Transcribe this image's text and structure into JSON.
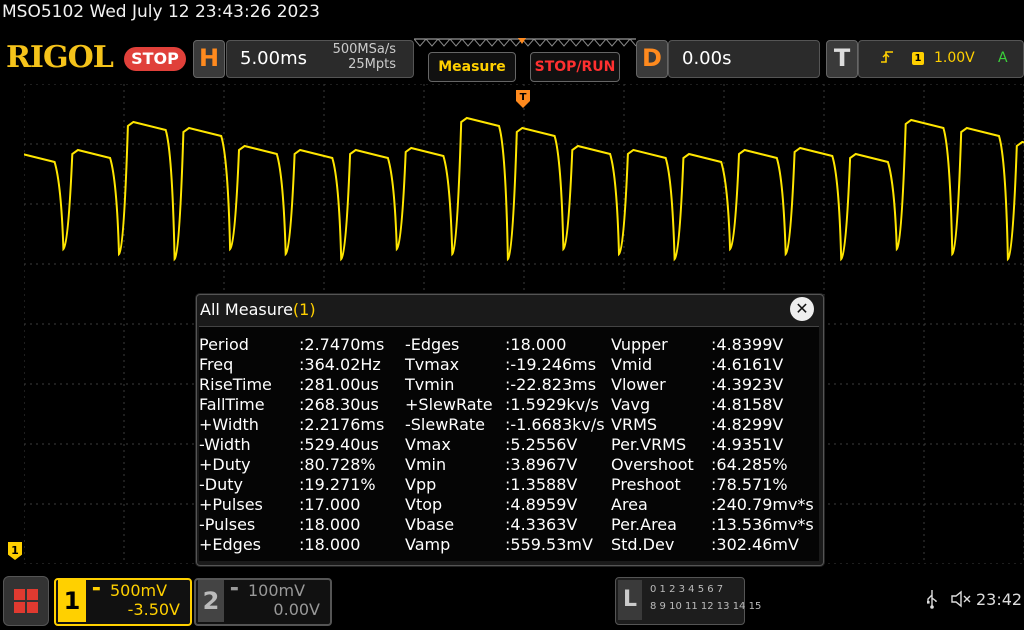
{
  "header": {
    "status_line": "MSO5102  Wed July 12 23:43:26 2023",
    "logo": "RIGOL",
    "run_state": "STOP",
    "horizontal": {
      "letter": "H",
      "timebase": "5.00ms",
      "sample_rate": "500MSa/s",
      "memory_depth": "25Mpts"
    },
    "measure_button": "Measure",
    "stoprun_button": "STOP/RUN",
    "delay": {
      "letter": "D",
      "value": "0.00s"
    },
    "trigger": {
      "letter": "T",
      "channel": "1",
      "level": "1.00V",
      "mode": "A",
      "edge_icon": "rising-edge-icon"
    }
  },
  "measure_panel": {
    "title": "All Measure",
    "count": "(1)",
    "close_icon": "close-icon",
    "columns": [
      [
        {
          "name": "Period",
          "value": ":2.7470ms"
        },
        {
          "name": "Freq",
          "value": ":364.02Hz"
        },
        {
          "name": "RiseTime",
          "value": ":281.00us"
        },
        {
          "name": "FallTime",
          "value": ":268.30us"
        },
        {
          "name": "+Width",
          "value": ":2.2176ms"
        },
        {
          "name": "-Width",
          "value": ":529.40us"
        },
        {
          "name": "+Duty",
          "value": ":80.728%"
        },
        {
          "name": "-Duty",
          "value": ":19.271%"
        },
        {
          "name": "+Pulses",
          "value": ":17.000"
        },
        {
          "name": "-Pulses",
          "value": ":18.000"
        },
        {
          "name": "+Edges",
          "value": ":18.000"
        }
      ],
      [
        {
          "name": "-Edges",
          "value": ":18.000"
        },
        {
          "name": "Tvmax",
          "value": ":-19.246ms"
        },
        {
          "name": "Tvmin",
          "value": ":-22.823ms"
        },
        {
          "name": "+SlewRate",
          "value": ":1.5929kv/s"
        },
        {
          "name": "-SlewRate",
          "value": ":-1.6683kv/s"
        },
        {
          "name": "Vmax",
          "value": ":5.2556V"
        },
        {
          "name": "Vmin",
          "value": ":3.8967V"
        },
        {
          "name": "Vpp",
          "value": ":1.3588V"
        },
        {
          "name": "Vtop",
          "value": ":4.8959V"
        },
        {
          "name": "Vbase",
          "value": ":4.3363V"
        },
        {
          "name": "Vamp",
          "value": ":559.53mV"
        }
      ],
      [
        {
          "name": "Vupper",
          "value": ":4.8399V"
        },
        {
          "name": "Vmid",
          "value": ":4.6161V"
        },
        {
          "name": "Vlower",
          "value": ":4.3923V"
        },
        {
          "name": "Vavg",
          "value": ":4.8158V"
        },
        {
          "name": "VRMS",
          "value": ":4.8299V"
        },
        {
          "name": "Per.VRMS",
          "value": ":4.9351V"
        },
        {
          "name": "Overshoot",
          "value": ":64.285%"
        },
        {
          "name": "Preshoot",
          "value": ":78.571%"
        },
        {
          "name": "Area",
          "value": ":240.79mv*s"
        },
        {
          "name": "Per.Area",
          "value": ":13.536mv*s"
        },
        {
          "name": "Std.Dev",
          "value": ":302.46mV"
        }
      ]
    ]
  },
  "channels": [
    {
      "number": "1",
      "scale": "500mV",
      "offset": "-3.50V",
      "active": true,
      "color": "#ffd000"
    },
    {
      "number": "2",
      "scale": "100mV",
      "offset": "0.00V",
      "active": false,
      "color": "#999999"
    }
  ],
  "ch1_marker": "1",
  "logic": {
    "letter": "L",
    "row1": "0 1 2 3   4 5 6 7",
    "row2": "8 9 10 11  12 13 14 15"
  },
  "status_bar": {
    "time": "23:42",
    "usb_icon": "usb-icon",
    "sound_icon": "speaker-muted-icon"
  },
  "waveform": {
    "color": "#ffe600",
    "periods_visible": 18,
    "high_level_div": 1.0,
    "low_level_div": 0.0
  }
}
